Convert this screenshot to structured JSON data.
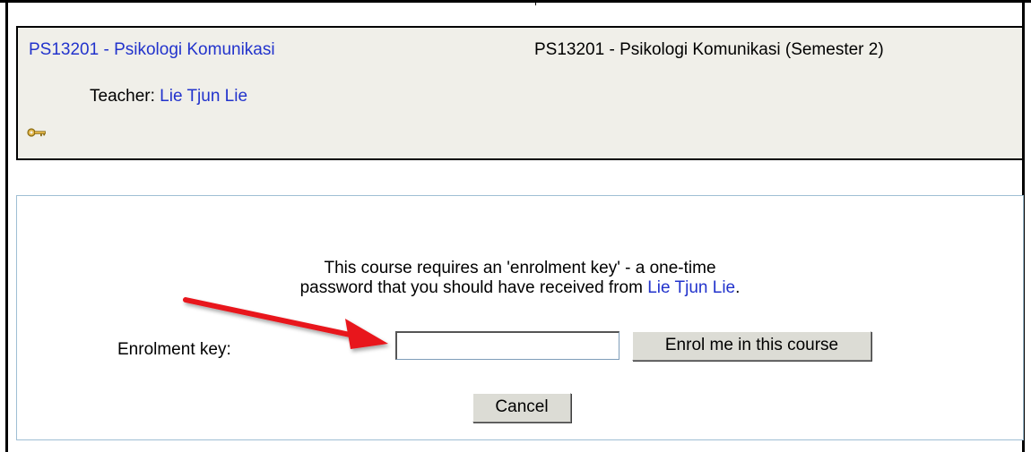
{
  "course": {
    "short_name": "PS13201 - Psikologi Komunikasi",
    "full_name": "PS13201 - Psikologi Komunikasi (Semester 2)",
    "teacher_label": "Teacher:",
    "teacher_name": "Lie Tjun Lie",
    "key_icon": "key-icon"
  },
  "enrolment": {
    "message_line1": "This course requires an 'enrolment key' - a one-time",
    "message_line2_prefix": "password that you should have received from",
    "message_teacher": "Lie Tjun Lie",
    "message_suffix": ".",
    "key_label": "Enrolment key:",
    "key_value": "",
    "enrol_button": "Enrol me in this course",
    "cancel_button": "Cancel"
  },
  "colors": {
    "link": "#2233cc",
    "course_box_bg": "#f0efe9",
    "arrow": "#e8151b"
  }
}
